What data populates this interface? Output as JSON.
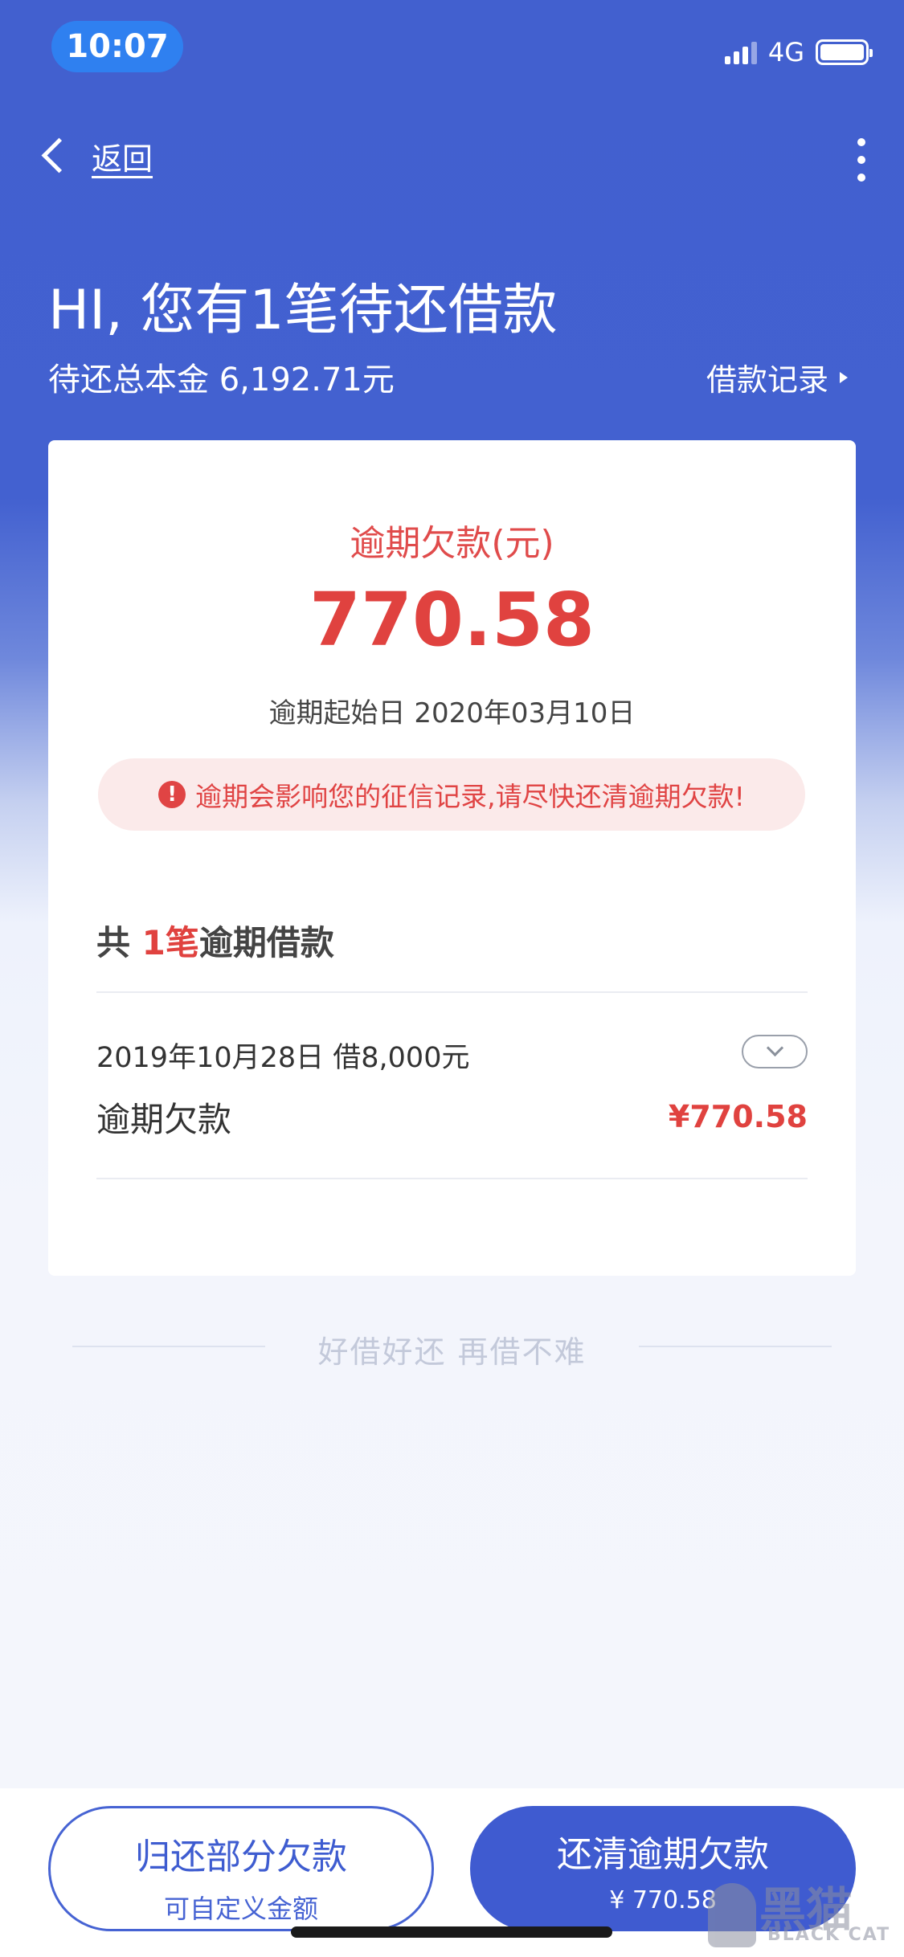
{
  "status": {
    "time": "10:07",
    "network": "4G"
  },
  "nav": {
    "back_label": "返回"
  },
  "header": {
    "greeting": "HI, 您有1笔待还借款",
    "principal": "待还总本金 6,192.71元",
    "records_link": "借款记录"
  },
  "card": {
    "overdue_label": "逾期欠款(元)",
    "overdue_amount": "770.58",
    "start_date": "逾期起始日 2020年03月10日",
    "warning": "逾期会影响您的征信记录,请尽快还清逾期欠款!",
    "count_prefix": "共",
    "count_num": "1笔",
    "count_suffix": "逾期借款",
    "loan": {
      "date": "2019年10月28日 借8,000元",
      "label": "逾期欠款",
      "amount": "¥770.58"
    }
  },
  "slogan": "好借好还 再借不难",
  "buttons": {
    "partial_title": "归还部分欠款",
    "partial_sub": "可自定义金额",
    "clear_title": "还清逾期欠款",
    "clear_sub": "¥ 770.58"
  },
  "watermark": {
    "line1": "黑猫",
    "line2": "BLACK CAT"
  },
  "colors": {
    "header_blue": "#4361d0",
    "accent_red": "#e0423f",
    "button_blue": "#3f5bd0"
  }
}
